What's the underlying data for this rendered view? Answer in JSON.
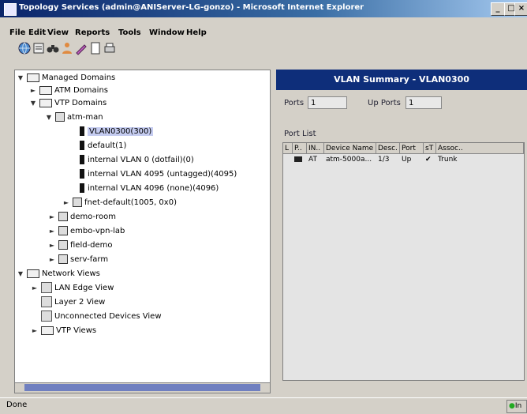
{
  "window": {
    "title": "Topology Services (admin@ANIServer-LG-gonzo) - Microsoft Internet Explorer"
  },
  "menu": [
    "File",
    "Edit",
    "View",
    "Reports",
    "Tools",
    "Window",
    "Help"
  ],
  "toolbar": {
    "icons": [
      "globe-icon",
      "print-icon",
      "binoculars-icon",
      "person-icon",
      "pencil-icon",
      "page-icon",
      "printer-setup-icon"
    ]
  },
  "tree": {
    "root": "Managed Domains",
    "atm": "ATM Domains",
    "vtp": "VTP Domains",
    "atm_man": "atm-man",
    "vlans": [
      "VLAN0300(300)",
      "default(1)",
      "internal VLAN 0 (dotfail)(0)",
      "internal VLAN 4095 (untagged)(4095)",
      "internal VLAN 4096 (none)(4096)"
    ],
    "fnet": "fnet-default(1005, 0x0)",
    "domains": [
      "demo-room",
      "embo-vpn-lab",
      "field-demo",
      "serv-farm"
    ],
    "network_views": "Network Views",
    "views": [
      "LAN Edge View",
      "Layer 2 View",
      "Unconnected Devices View",
      "VTP Views"
    ]
  },
  "summary": {
    "title": "VLAN Summary - VLAN0300",
    "ports_label": "Ports",
    "ports_value": "1",
    "up_ports_label": "Up Ports",
    "up_ports_value": "1",
    "port_list_label": "Port List"
  },
  "table": {
    "headers": [
      "L",
      "P..",
      "IN..",
      "Device Name",
      "Desc.",
      "Port",
      "sT",
      "Assoc.."
    ],
    "row": [
      "",
      "",
      "AT",
      "atm-5000a...",
      "1/3",
      "Up",
      "",
      "Trunk"
    ]
  },
  "status": {
    "text": "Done",
    "zone": "In"
  }
}
